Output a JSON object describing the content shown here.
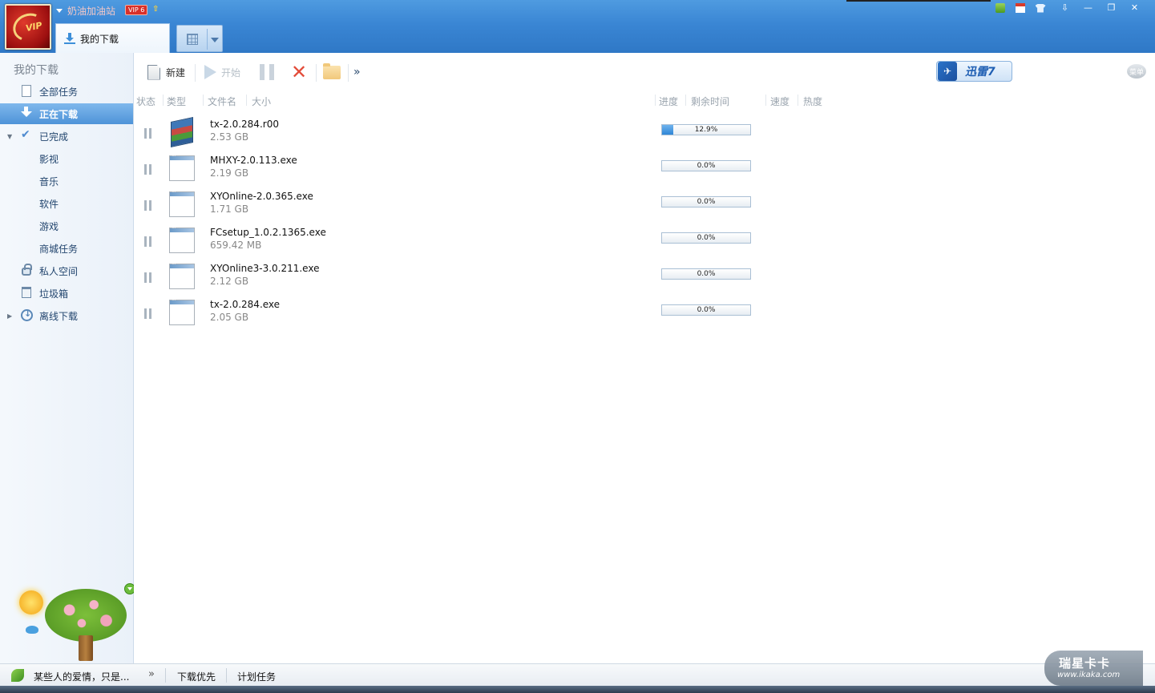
{
  "header": {
    "username": "奶油加油站",
    "vip_badge": "VIP 6",
    "vip_up": "⇧",
    "active_tab": "我的下载"
  },
  "window_controls": {
    "menu": "⇩",
    "minimize": "—",
    "restore": "❐",
    "close": "✕"
  },
  "sidebar": {
    "title": "我的下载",
    "items": [
      {
        "label": "全部任务",
        "icon": "document-icon"
      },
      {
        "label": "正在下载",
        "icon": "download-arrow-icon",
        "active": true
      },
      {
        "label": "已完成",
        "icon": "check-icon",
        "expander": "▼"
      },
      {
        "label": "影视"
      },
      {
        "label": "音乐"
      },
      {
        "label": "软件"
      },
      {
        "label": "游戏"
      },
      {
        "label": "商城任务"
      },
      {
        "label": "私人空间",
        "icon": "lock-icon"
      },
      {
        "label": "垃圾箱",
        "icon": "trash-icon"
      },
      {
        "label": "离线下载",
        "icon": "cloud-download-icon",
        "expander": "▶"
      }
    ]
  },
  "toolbar": {
    "new_label": "新建",
    "start_label": "开始",
    "more": "»",
    "brand": "迅雷7",
    "menu_label": "菜单"
  },
  "columns": {
    "status": "状态",
    "type": "类型",
    "filename": "文件名",
    "size": "大小",
    "progress": "进度",
    "remaining": "剩余时间",
    "speed": "速度",
    "heat": "热度"
  },
  "tasks": [
    {
      "name": "tx-2.0.284.r00",
      "size": "2.53 GB",
      "progress_label": "12.9%",
      "progress": 12.9,
      "icon": "rar-archive-icon"
    },
    {
      "name": "MHXY-2.0.113.exe",
      "size": "2.19 GB",
      "progress_label": "0.0%",
      "progress": 0,
      "icon": "exe-file-icon"
    },
    {
      "name": "XYOnline-2.0.365.exe",
      "size": "1.71 GB",
      "progress_label": "0.0%",
      "progress": 0,
      "icon": "exe-file-icon"
    },
    {
      "name": "FCsetup_1.0.2.1365.exe",
      "size": "659.42 MB",
      "progress_label": "0.0%",
      "progress": 0,
      "icon": "exe-file-icon"
    },
    {
      "name": "XYOnline3-3.0.211.exe",
      "size": "2.12 GB",
      "progress_label": "0.0%",
      "progress": 0,
      "icon": "exe-file-icon"
    },
    {
      "name": "tx-2.0.284.exe",
      "size": "2.05 GB",
      "progress_label": "0.0%",
      "progress": 0,
      "icon": "exe-file-icon"
    }
  ],
  "statusbar": {
    "song": "某些人的爱情，只是...",
    "more": "»",
    "download_priority": "下载优先",
    "scheduled_tasks": "计划任务"
  },
  "watermark": {
    "line1": "瑞星卡卡",
    "line2": "www.ikaka.com"
  },
  "colors": {
    "accent": "#3a86d4",
    "active_nav": "#4e93d8",
    "progress_fill": "#2f86d6",
    "delete_red": "#e34c3a"
  }
}
